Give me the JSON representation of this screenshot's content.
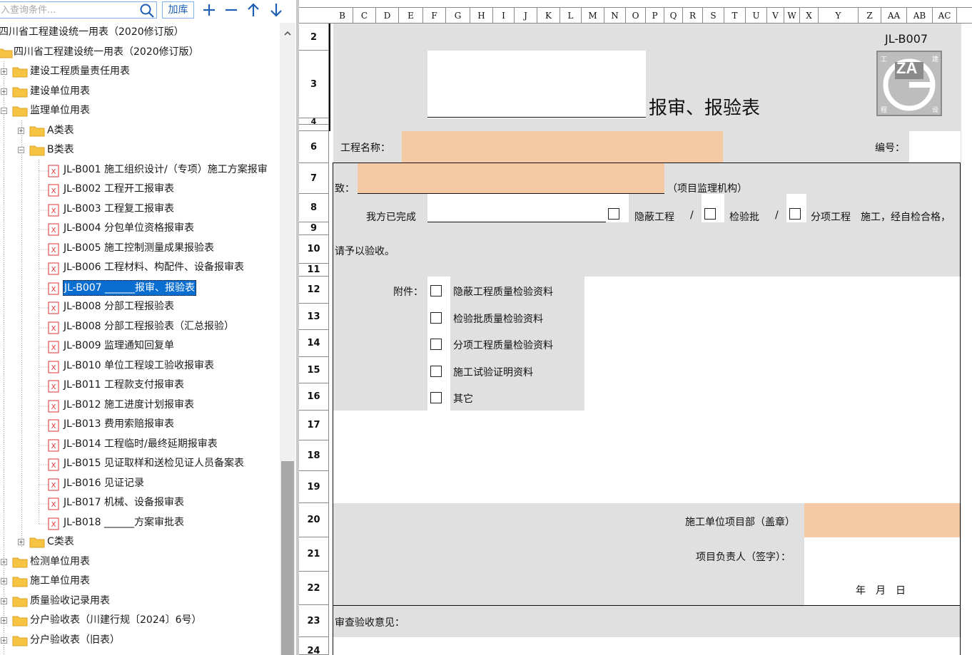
{
  "toolbar": {
    "search_placeholder": "入查询条件...",
    "add_lib_label": "加库"
  },
  "tree": {
    "root_label": "四川省工程建设统一用表（2020修订版）",
    "top_label": "四川省工程建设统一用表（2020修订版）",
    "quality_resp": "建设工程质量责任用表",
    "owner": "建设单位用表",
    "supervision": "监理单位用表",
    "class_a": "A类表",
    "class_b": "B类表",
    "items": [
      "JL-B001 施工组织设计/（专项）施工方案报审",
      "JL-B002 工程开工报审表",
      "JL-B003 工程复工报审表",
      "JL-B004 分包单位资格报审表",
      "JL-B005 施工控制测量成果报验表",
      "JL-B006 工程材料、构配件、设备报审表",
      "JL-B007 ______报审、报验表",
      "JL-B008 分部工程报验表",
      "JL-B008 分部工程报验表（汇总报验）",
      "JL-B009 监理通知回复单",
      "JL-B010 单位工程竣工验收报审表",
      "JL-B011 工程款支付报审表",
      "JL-B012 施工进度计划报审表",
      "JL-B013 费用索赔报审表",
      "JL-B014 工程临时/最终延期报审表",
      "JL-B015 见证取样和送检见证人员备案表",
      "JL-B016 见证记录",
      "JL-B017 机械、设备报审表",
      "JL-B018 ______方案审批表"
    ],
    "class_c": "C类表",
    "testing": "检测单位用表",
    "construction": "施工单位用表",
    "quality_accept": "质量验收记录用表",
    "household_2024": "分户验收表（川建行规〔2024〕6号）",
    "household_old": "分户验收表（旧表）"
  },
  "sheet": {
    "columns": [
      "B",
      "C",
      "D",
      "E",
      "F",
      "G",
      "H",
      "I",
      "J",
      "K",
      "L",
      "M",
      "N",
      "O",
      "P",
      "Q",
      "R",
      "S",
      "T",
      "U",
      "V",
      "W",
      "X",
      "Y",
      "Z",
      "AA",
      "AB",
      "AC"
    ],
    "rows": [
      "2",
      "3",
      "4",
      "6",
      "7",
      "8",
      "9",
      "10",
      "11",
      "12",
      "13",
      "14",
      "15",
      "16",
      "17",
      "18",
      "19",
      "20",
      "21",
      "22",
      "23",
      "24"
    ],
    "form_code": "JL-B007",
    "logo_text": "ZA",
    "logo_corners": [
      "工",
      "建",
      "程",
      "设"
    ],
    "title": "报审、报验表",
    "project_name_label": "工程名称：",
    "number_label": "编号：",
    "to_label": "致：",
    "to_suffix": "（项目监理机构）",
    "completed_label": "我方已完成",
    "hidden_work": "隐蔽工程",
    "slash": "/",
    "inspection_lot": "检验批",
    "sub_item": "分项工程",
    "self_check": "施工，经自检合格，",
    "please_accept": "请予以验收。",
    "attachment_label": "附件：",
    "attachments": [
      "隐蔽工程质量检验资料",
      "检验批质量检验资料",
      "分项工程质量检验资料",
      "施工试验证明资料",
      "其它"
    ],
    "dept_seal": "施工单位项目部（盖章）",
    "manager_sign": "项目负责人（签字）：",
    "date_label": "年　月　日",
    "review_opinion": "审查验收意见："
  }
}
